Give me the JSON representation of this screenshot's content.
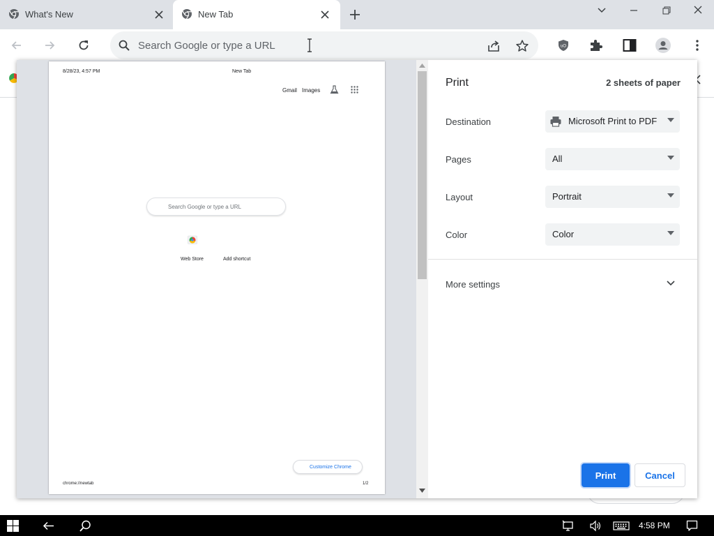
{
  "tabs": [
    {
      "title": "What's New",
      "active": false,
      "icon": "chrome-icon"
    },
    {
      "title": "New Tab",
      "active": true,
      "icon": "chrome-icon"
    }
  ],
  "toolbar": {
    "omnibox_placeholder": "Search Google or type a URL"
  },
  "preview": {
    "header_datetime": "8/28/23, 4:57 PM",
    "header_title": "New Tab",
    "gmail_link": "Gmail",
    "images_link": "Images",
    "search_placeholder": "Search Google or type a URL",
    "shortcut_webstore": "Web Store",
    "shortcut_add": "Add shortcut",
    "customize_label": "Customize Chrome",
    "footer_url": "chrome://newtab",
    "footer_page": "1/2"
  },
  "print": {
    "title": "Print",
    "sheets": "2 sheets of paper",
    "destination_label": "Destination",
    "destination_value": "Microsoft Print to PDF",
    "pages_label": "Pages",
    "pages_value": "All",
    "layout_label": "Layout",
    "layout_value": "Portrait",
    "color_label": "Color",
    "color_value": "Color",
    "more_settings": "More settings",
    "print_button": "Print",
    "cancel_button": "Cancel"
  },
  "taskbar": {
    "time": "4:58 PM"
  },
  "colors": {
    "accent": "#1a73e8",
    "tabstrip": "#dee1e6",
    "omnibox": "#f1f3f4",
    "taskbar": "#000000"
  }
}
